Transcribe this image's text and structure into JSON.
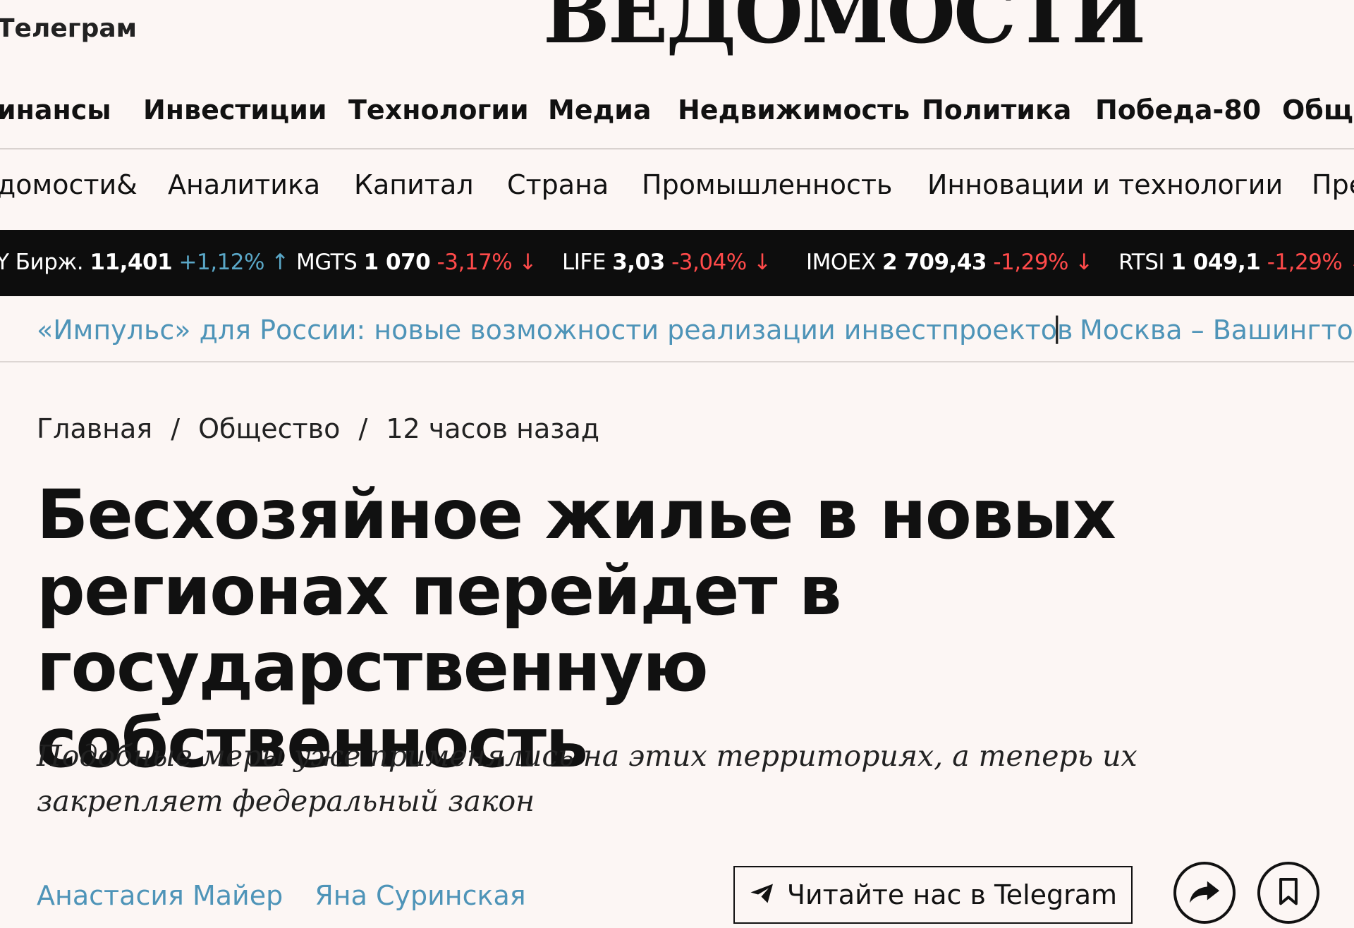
{
  "header": {
    "telegram_link": "Телеграм",
    "logo": "ВЕДОМОСТИ"
  },
  "nav_main": [
    "инансы",
    "Инвестиции",
    "Технологии",
    "Медиа",
    "Недвижимость",
    "Политика",
    "Победа-80",
    "Обще"
  ],
  "nav_sub": [
    "домости&",
    "Аналитика",
    "Капитал",
    "Страна",
    "Промышленность",
    "Инновации и технологии",
    "Пре"
  ],
  "ticker": [
    {
      "name": "Y Бирж.",
      "value": "11,401",
      "change": "+1,12%",
      "dir": "up"
    },
    {
      "name": "MGTS",
      "value": "1 070",
      "change": "-3,17%",
      "dir": "down"
    },
    {
      "name": "LIFE",
      "value": "3,03",
      "change": "-3,04%",
      "dir": "down"
    },
    {
      "name": "IMOEX",
      "value": "2 709,43",
      "change": "-1,29%",
      "dir": "down"
    },
    {
      "name": "RTSI",
      "value": "1 049,1",
      "change": "-1,29%",
      "dir": "down"
    }
  ],
  "promo": {
    "link1": "«Импульс» для России: новые возможности реализации инвестпроектов",
    "separator": "|",
    "link2": "Москва – Вашингтон"
  },
  "breadcrumb": {
    "home": "Главная",
    "section": "Общество",
    "time": "12 часов назад",
    "sep": "/"
  },
  "article": {
    "title": "Бесхозяйное жилье в новых регионах перейдет в государственную собственность",
    "subtitle": "Подобные меры уже применялись на этих территориях, а теперь их закрепляет федеральный закон",
    "authors": [
      "Анастасия Майер",
      "Яна Суринская"
    ],
    "telegram_button": "Читайте нас в Telegram"
  },
  "icons": {
    "telegram": "telegram-plane-icon",
    "share": "share-arrow-icon",
    "bookmark": "bookmark-icon"
  },
  "colors": {
    "background": "#fcf6f4",
    "link_blue": "#4e94b8",
    "ticker_bg": "#0d0d0d",
    "up": "#5aa7c7",
    "down": "#ff4a4a"
  }
}
